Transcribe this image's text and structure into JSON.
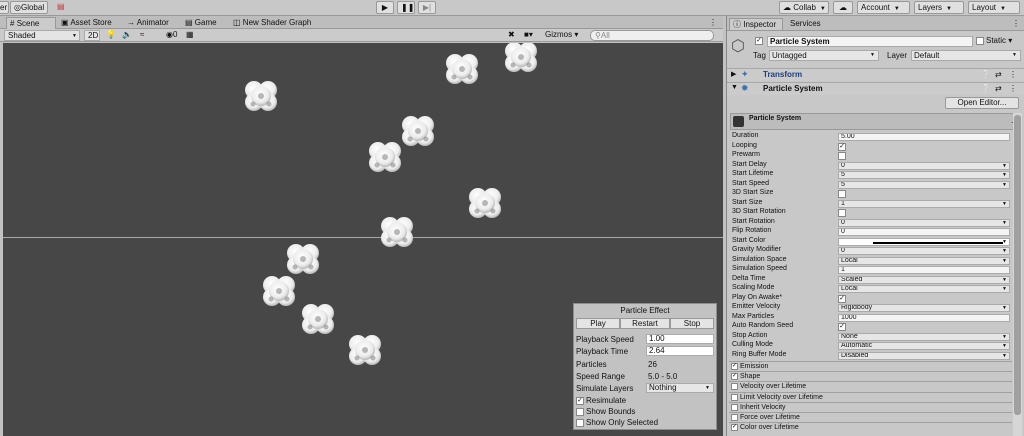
{
  "toolbar": {
    "pivot_label": "er",
    "global_label": "Global",
    "collab_label": "Collab",
    "account_label": "Account",
    "layers_label": "Layers",
    "layout_label": "Layout"
  },
  "tabs": [
    "Scene",
    "Asset Store",
    "Animator",
    "Game",
    "New Shader Graph"
  ],
  "scene_toolbar": {
    "shading_mode": "Shaded",
    "mode_2d": "2D",
    "hidden_count": "0",
    "gizmos_label": "Gizmos",
    "search_placeholder": "All"
  },
  "particle_effect": {
    "title": "Particle Effect",
    "play_label": "Play",
    "restart_label": "Restart",
    "stop_label": "Stop",
    "playback_speed_label": "Playback Speed",
    "playback_speed_value": "1.00",
    "playback_time_label": "Playback Time",
    "playback_time_value": "2.64",
    "particles_label": "Particles",
    "particles_value": "26",
    "speed_range_label": "Speed Range",
    "speed_range_value": "5.0 - 5.0",
    "simulate_layers_label": "Simulate Layers",
    "simulate_layers_value": "Nothing",
    "resimulate_label": "Resimulate",
    "show_bounds_label": "Show Bounds",
    "show_only_selected_label": "Show Only Selected"
  },
  "inspector": {
    "tab_inspector": "Inspector",
    "tab_services": "Services",
    "object_name": "Particle System",
    "static_label": "Static",
    "tag_label": "Tag",
    "tag_value": "Untagged",
    "layer_label": "Layer",
    "layer_value": "Default",
    "transform_label": "Transform",
    "particle_system_label": "Particle System",
    "open_editor_label": "Open Editor...",
    "module_title": "Particle System",
    "properties": [
      {
        "label": "Duration",
        "kind": "text",
        "value": "5.00"
      },
      {
        "label": "Looping",
        "kind": "check",
        "checked": true
      },
      {
        "label": "Prewarm",
        "kind": "check",
        "checked": false
      },
      {
        "label": "Start Delay",
        "kind": "dd",
        "value": "0"
      },
      {
        "label": "Start Lifetime",
        "kind": "dd",
        "value": "5"
      },
      {
        "label": "Start Speed",
        "kind": "dd",
        "value": "5"
      },
      {
        "label": "3D Start Size",
        "kind": "check",
        "checked": false
      },
      {
        "label": "Start Size",
        "kind": "dd",
        "value": "1"
      },
      {
        "label": "3D Start Rotation",
        "kind": "check",
        "checked": false
      },
      {
        "label": "Start Rotation",
        "kind": "dd",
        "value": "0"
      },
      {
        "label": "Flip Rotation",
        "kind": "text",
        "value": "0"
      },
      {
        "label": "Start Color",
        "kind": "color",
        "value": ""
      },
      {
        "label": "Gravity Modifier",
        "kind": "dd",
        "value": "0"
      },
      {
        "label": "Simulation Space",
        "kind": "dd",
        "value": "Local"
      },
      {
        "label": "Simulation Speed",
        "kind": "text",
        "value": "1"
      },
      {
        "label": "Delta Time",
        "kind": "dd",
        "value": "Scaled"
      },
      {
        "label": "Scaling Mode",
        "kind": "dd",
        "value": "Local"
      },
      {
        "label": "Play On Awake*",
        "kind": "check",
        "checked": true
      },
      {
        "label": "Emitter Velocity",
        "kind": "dd",
        "value": "Rigidbody"
      },
      {
        "label": "Max Particles",
        "kind": "text",
        "value": "1000"
      },
      {
        "label": "Auto Random Seed",
        "kind": "check",
        "checked": true
      },
      {
        "label": "Stop Action",
        "kind": "dd",
        "value": "None"
      },
      {
        "label": "Culling Mode",
        "kind": "dd",
        "value": "Automatic"
      },
      {
        "label": "Ring Buffer Mode",
        "kind": "dd",
        "value": "Disabled"
      }
    ],
    "modules": [
      {
        "label": "Emission",
        "checked": true
      },
      {
        "label": "Shape",
        "checked": true
      },
      {
        "label": "Velocity over Lifetime",
        "checked": false
      },
      {
        "label": "Limit Velocity over Lifetime",
        "checked": false
      },
      {
        "label": "Inherit Velocity",
        "checked": false
      },
      {
        "label": "Force over Lifetime",
        "checked": false
      },
      {
        "label": "Color over Lifetime",
        "checked": true
      }
    ]
  },
  "colors": {
    "viewport_bg": "#474747",
    "panel_bg": "#c2c2c2",
    "inspector_bg": "#c8c8c8",
    "particle": "#f2f2f2"
  }
}
